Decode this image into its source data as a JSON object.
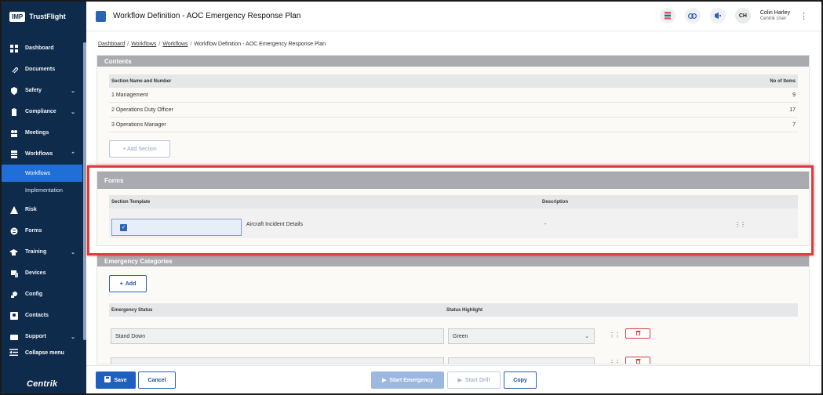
{
  "brand": {
    "logo": "IMP",
    "name": "TrustFlight",
    "footer": "Centrik"
  },
  "sidebar": {
    "items": [
      {
        "label": "Dashboard",
        "icon": "dashboard-icon",
        "chevron": false
      },
      {
        "label": "Documents",
        "icon": "paperclip-icon",
        "chevron": false
      },
      {
        "label": "Safety",
        "icon": "shield-icon",
        "chevron": true
      },
      {
        "label": "Compliance",
        "icon": "clipboard-icon",
        "chevron": true
      },
      {
        "label": "Meetings",
        "icon": "meeting-icon",
        "chevron": false
      },
      {
        "label": "Workflows",
        "icon": "workflow-icon",
        "chevron": true,
        "expanded": true
      }
    ],
    "sub_items": [
      {
        "label": "Workflows",
        "active": true
      },
      {
        "label": "Implementation",
        "active": false
      }
    ],
    "items_after": [
      {
        "label": "Risk",
        "icon": "risk-icon",
        "chevron": false
      },
      {
        "label": "Forms",
        "icon": "forms-icon",
        "chevron": false
      },
      {
        "label": "Training",
        "icon": "graduation-cap-icon",
        "chevron": true
      },
      {
        "label": "Devices",
        "icon": "devices-icon",
        "chevron": false
      },
      {
        "label": "Config",
        "icon": "config-icon",
        "chevron": false
      },
      {
        "label": "Contacts",
        "icon": "contacts-icon",
        "chevron": false
      },
      {
        "label": "Support",
        "icon": "support-icon",
        "chevron": true
      }
    ],
    "collapse_label": "Collapse menu",
    "chevron_down": "⌄",
    "chevron_up": "⌃"
  },
  "header": {
    "title": "Workflow Definition - AOC Emergency Response Plan",
    "user_initials": "CH",
    "user_name": "Colin Harley",
    "user_role": "Centrik User",
    "kebab": "⋮"
  },
  "breadcrumb": {
    "items": [
      "Dashboard",
      "Workflows",
      "Workflows"
    ],
    "current": "Workflow Definition - AOC Emergency Response Plan",
    "separator": "/"
  },
  "contents": {
    "heading": "Contents",
    "col_name": "Section Name and Number",
    "col_items": "No of Items",
    "rows": [
      {
        "name": "1 Management",
        "count": "9"
      },
      {
        "name": "2 Operations Duty Officer",
        "count": "17"
      },
      {
        "name": "3 Operations Manager",
        "count": "7"
      }
    ],
    "add_label": "+ Add Section"
  },
  "forms": {
    "heading": "Forms",
    "col_template": "Section Template",
    "col_description": "Description",
    "row": {
      "name": "Aircraft Incident Details",
      "description": "-",
      "checked": true
    }
  },
  "emergency": {
    "heading": "Emergency Categories",
    "add_label": "Add",
    "add_plus": "+",
    "col_status": "Emergency Status",
    "col_highlight": "Status Highlight",
    "rows": [
      {
        "status": "Stand Down",
        "highlight": "Green"
      },
      {
        "status": "",
        "highlight": ""
      }
    ],
    "select_caret": "⌄",
    "grip": "⋮⋮"
  },
  "footer": {
    "save": "Save",
    "cancel": "Cancel",
    "start_emergency": "Start Emergency",
    "start_drill": "Start Drill",
    "copy": "Copy",
    "play_glyph": "▶"
  },
  "colors": {
    "sidebar_bg": "#0f2b4c",
    "accent": "#1f6fd6",
    "highlight_border": "#e13a3a",
    "danger": "#d43f3f"
  }
}
